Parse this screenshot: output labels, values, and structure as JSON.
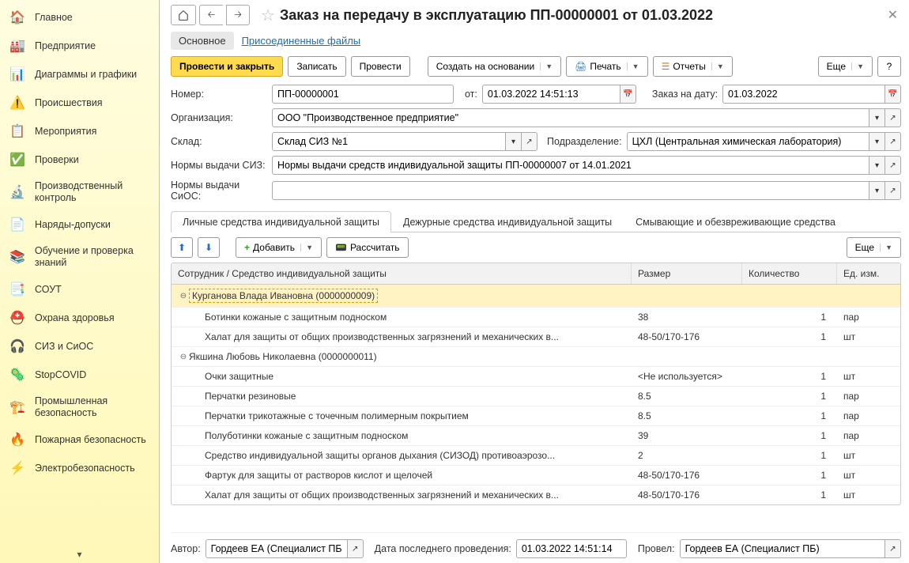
{
  "sidebar": {
    "items": [
      {
        "label": "Главное",
        "icon": "🏠"
      },
      {
        "label": "Предприятие",
        "icon": "🏭"
      },
      {
        "label": "Диаграммы и графики",
        "icon": "📊"
      },
      {
        "label": "Происшествия",
        "icon": "⚠️"
      },
      {
        "label": "Мероприятия",
        "icon": "📋"
      },
      {
        "label": "Проверки",
        "icon": "✅"
      },
      {
        "label": "Производственный контроль",
        "icon": "🔬"
      },
      {
        "label": "Наряды-допуски",
        "icon": "📄"
      },
      {
        "label": "Обучение и проверка знаний",
        "icon": "📚"
      },
      {
        "label": "СОУТ",
        "icon": "📑"
      },
      {
        "label": "Охрана здоровья",
        "icon": "⛑️"
      },
      {
        "label": "СИЗ и СиОС",
        "icon": "🎧"
      },
      {
        "label": "StopCOVID",
        "icon": "🦠"
      },
      {
        "label": "Промышленная безопасность",
        "icon": "🏗️"
      },
      {
        "label": "Пожарная безопасность",
        "icon": "🔥"
      },
      {
        "label": "Электробезопасность",
        "icon": "⚡"
      }
    ]
  },
  "header": {
    "title": "Заказ на передачу в эксплуатацию ПП-00000001 от 01.03.2022"
  },
  "topTabs": {
    "main": "Основное",
    "files": "Присоединенные файлы"
  },
  "toolbar": {
    "postClose": "Провести и закрыть",
    "save": "Записать",
    "post": "Провести",
    "createBased": "Создать на основании",
    "print": "Печать",
    "reports": "Отчеты",
    "more": "Еще",
    "help": "?"
  },
  "form": {
    "numberLabel": "Номер:",
    "number": "ПП-00000001",
    "fromLabel": "от:",
    "from": "01.03.2022 14:51:13",
    "orderDateLabel": "Заказ на дату:",
    "orderDate": "01.03.2022",
    "orgLabel": "Организация:",
    "org": "ООО \"Производственное предприятие\"",
    "warehouseLabel": "Склад:",
    "warehouse": "Склад СИЗ №1",
    "divisionLabel": "Подразделение:",
    "division": "ЦХЛ (Центральная химическая лаборатория)",
    "normsSizLabel": "Нормы выдачи СИЗ:",
    "normsSiz": "Нормы выдачи средств индивидуальной защиты ПП-00000007 от 14.01.2021",
    "normsSiosLabel": "Нормы выдачи СиОС:",
    "normsSios": ""
  },
  "subtabs": {
    "personal": "Личные средства индивидуальной защиты",
    "duty": "Дежурные средства индивидуальной защиты",
    "washing": "Смывающие и обезвреживающие средства"
  },
  "gridToolbar": {
    "add": "Добавить",
    "calc": "Рассчитать",
    "more": "Еще"
  },
  "gridHeader": {
    "c1": "Сотрудник / Средство индивидуальной защиты",
    "c2": "Размер",
    "c3": "Количество",
    "c4": "Ед. изм."
  },
  "gridData": [
    {
      "type": "group",
      "name": "Курганова Влада Ивановна (0000000009)",
      "selected": true
    },
    {
      "type": "item",
      "name": "Ботинки кожаные с защитным подноском",
      "size": "38",
      "qty": "1",
      "unit": "пар"
    },
    {
      "type": "item",
      "name": "Халат для защиты от общих производственных загрязнений и механических в...",
      "size": "48-50/170-176",
      "qty": "1",
      "unit": "шт"
    },
    {
      "type": "group",
      "name": "Якшина Любовь Николаевна (0000000011)"
    },
    {
      "type": "item",
      "name": "Очки защитные",
      "size": "<Не используется>",
      "qty": "1",
      "unit": "шт"
    },
    {
      "type": "item",
      "name": "Перчатки резиновые",
      "size": "8.5",
      "qty": "1",
      "unit": "пар"
    },
    {
      "type": "item",
      "name": "Перчатки трикотажные с точечным полимерным покрытием",
      "size": "8.5",
      "qty": "1",
      "unit": "пар"
    },
    {
      "type": "item",
      "name": "Полуботинки кожаные с защитным подноском",
      "size": "39",
      "qty": "1",
      "unit": "пар"
    },
    {
      "type": "item",
      "name": "Средство индивидуальной защиты органов дыхания (СИЗОД) противоаэрозо...",
      "size": "2",
      "qty": "1",
      "unit": "шт"
    },
    {
      "type": "item",
      "name": "Фартук для защиты от растворов кислот и щелочей",
      "size": "48-50/170-176",
      "qty": "1",
      "unit": "шт"
    },
    {
      "type": "item",
      "name": "Халат для защиты от общих производственных загрязнений и механических в...",
      "size": "48-50/170-176",
      "qty": "1",
      "unit": "шт"
    }
  ],
  "footer": {
    "authorLabel": "Автор:",
    "author": "Гордеев ЕА (Специалист ПБ)",
    "lastPostLabel": "Дата последнего проведения:",
    "lastPost": "01.03.2022 14:51:14",
    "postedByLabel": "Провел:",
    "postedBy": "Гордеев ЕА (Специалист ПБ)"
  }
}
